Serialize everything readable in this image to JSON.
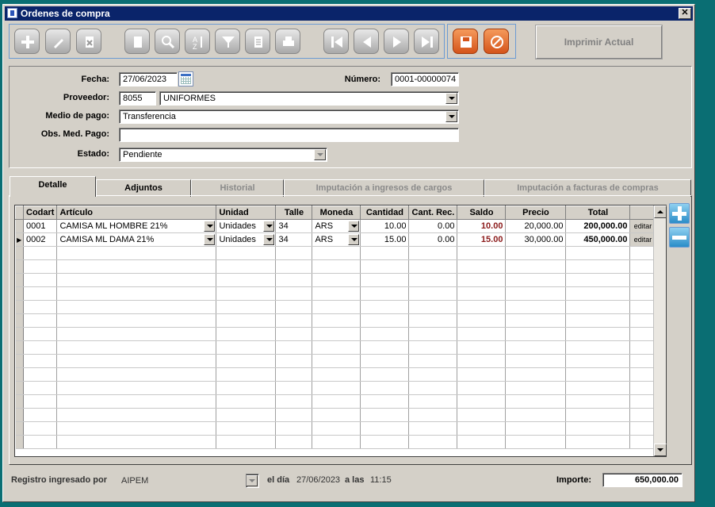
{
  "window": {
    "title": "Ordenes de compra"
  },
  "toolbar": {
    "print_current_label": "Imprimir Actual"
  },
  "form": {
    "fecha_label": "Fecha:",
    "fecha_value": "27/06/2023",
    "numero_label": "Número:",
    "numero_value": "0001-00000074",
    "proveedor_label": "Proveedor:",
    "proveedor_code": "8055",
    "proveedor_name": "UNIFORMES",
    "medio_pago_label": "Medio de pago:",
    "medio_pago_value": "Transferencia",
    "obs_label": "Obs. Med. Pago:",
    "obs_value": "",
    "estado_label": "Estado:",
    "estado_value": "Pendiente"
  },
  "tabs": [
    {
      "label": "Detalle"
    },
    {
      "label": "Adjuntos"
    },
    {
      "label": "Historial"
    },
    {
      "label": "Imputación a ingresos de cargos"
    },
    {
      "label": "Imputación a facturas de compras"
    }
  ],
  "grid": {
    "columns": [
      "Codart",
      "Artículo",
      "Unidad",
      "Talle",
      "Moneda",
      "Cantidad",
      "Cant. Rec.",
      "Saldo",
      "Precio",
      "Total"
    ],
    "rows": [
      {
        "codart": "0001",
        "articulo": "CAMISA ML HOMBRE 21%",
        "unidad": "Unidades",
        "talle": "34",
        "moneda": "ARS",
        "cantidad": "10.00",
        "cant_rec": "0.00",
        "saldo": "10.00",
        "precio": "20,000.00",
        "total": "200,000.00",
        "edit": "editar"
      },
      {
        "codart": "0002",
        "articulo": "CAMISA ML DAMA 21%",
        "unidad": "Unidades",
        "talle": "34",
        "moneda": "ARS",
        "cantidad": "15.00",
        "cant_rec": "0.00",
        "saldo": "15.00",
        "precio": "30,000.00",
        "total": "450,000.00",
        "edit": "editar"
      }
    ],
    "current_row_marker": "▶"
  },
  "footer": {
    "registro_label": "Registro ingresado por",
    "registro_user": "AIPEM",
    "el_dia_label": "el día",
    "el_dia_value": "27/06/2023",
    "a_las_label": "a las",
    "a_las_value": "11:15",
    "importe_label": "Importe:",
    "importe_value": "650,000.00"
  },
  "colors": {
    "title_bar": "#0a246a",
    "window_bg": "#d4d0c8",
    "desktop": "#0a6e73",
    "saldo": "#8b1a1a",
    "accent_orange": "#e0702a"
  },
  "icons": [
    "add-icon",
    "edit-icon",
    "delete-icon",
    "copy-icon",
    "search-icon",
    "sort-icon",
    "filter-icon",
    "report-icon",
    "print-icon",
    "first-record-icon",
    "previous-record-icon",
    "next-record-icon",
    "last-record-icon",
    "save-icon",
    "cancel-icon",
    "calendar-icon",
    "add-row-icon",
    "remove-row-icon"
  ]
}
